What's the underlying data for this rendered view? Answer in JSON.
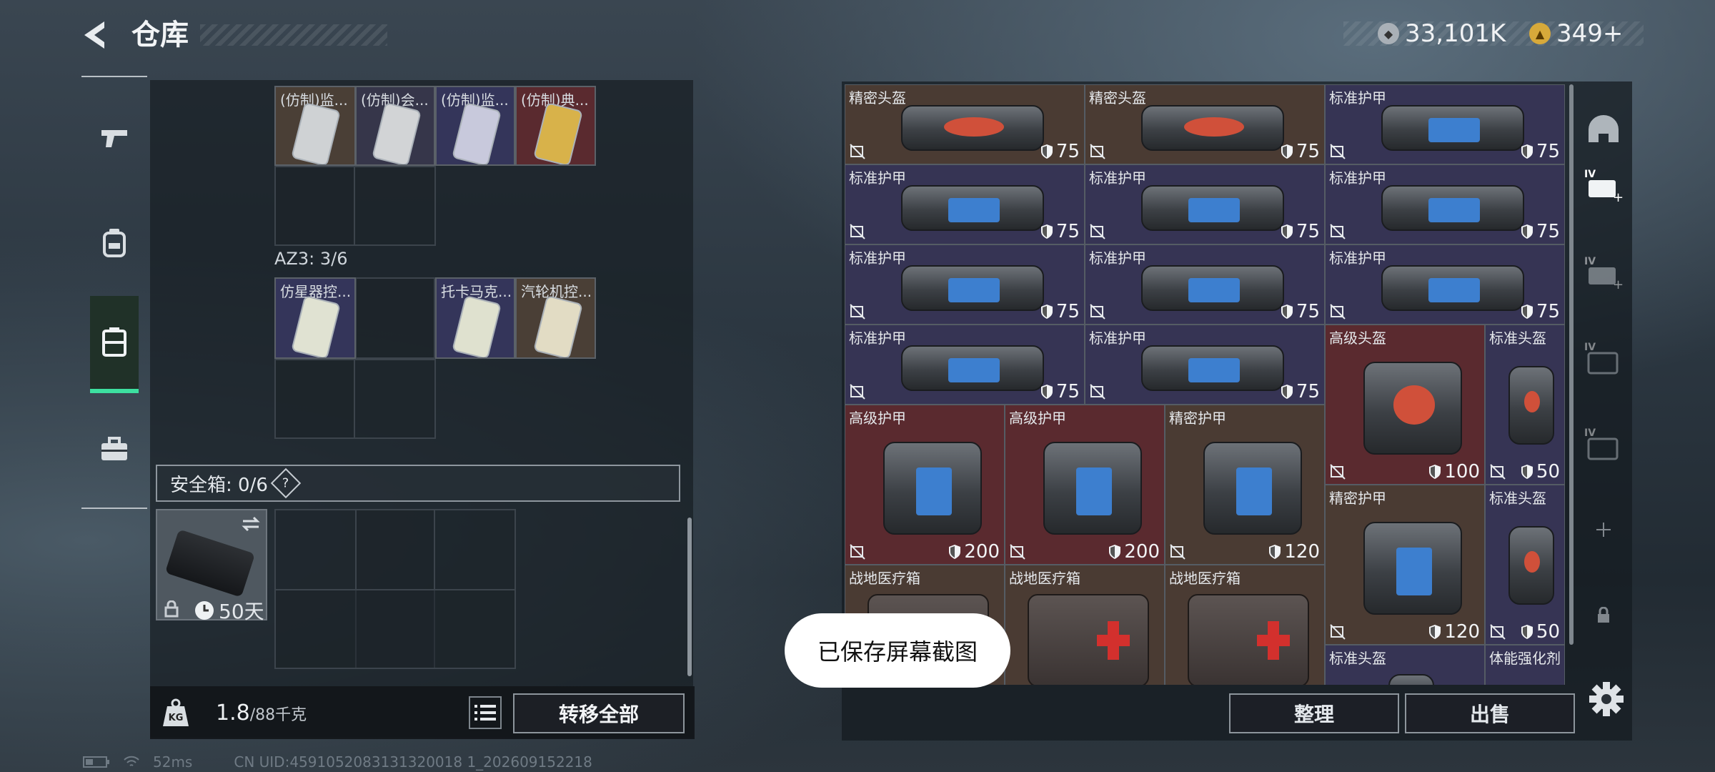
{
  "header": {
    "title": "仓库",
    "back_icon": "back-arrow-icon"
  },
  "currency": [
    {
      "icon": "silver-coin-icon",
      "value": "33,101K",
      "color": "#b8bec4"
    },
    {
      "icon": "gold-coin-icon",
      "value": "349+",
      "color": "#d7a93a"
    }
  ],
  "left_tabs": [
    {
      "name": "weapons",
      "icon": "pistol-icon"
    },
    {
      "name": "equipment",
      "icon": "backpack-icon"
    },
    {
      "name": "containers",
      "icon": "container-icon",
      "active": true
    },
    {
      "name": "toolbox",
      "icon": "toolbox-icon"
    }
  ],
  "left_items_top": [
    {
      "label": "(仿制)监...",
      "color": "#c9c9c9"
    },
    {
      "label": "(仿制)会...",
      "color": "#c9c9c9"
    },
    {
      "label": "(仿制)监...",
      "color": "#bfbfd8"
    },
    {
      "label": "(仿制)典...",
      "color": "#d8b24a"
    }
  ],
  "az3": {
    "label": "AZ3: 3/6"
  },
  "left_items_az3": [
    {
      "label": "仿星器控..."
    },
    {
      "label": "托卡马克..."
    },
    {
      "label": "汽轮机控..."
    }
  ],
  "safe_box": {
    "label": "安全箱: 0/6",
    "help": "?",
    "days": "50天"
  },
  "weight": {
    "current": "1.8",
    "max": "/88千克"
  },
  "transfer_label": "转移全部",
  "stash_items": [
    {
      "name": "精密头盔",
      "value": "75",
      "color": "brown",
      "kind": "helmet"
    },
    {
      "name": "精密头盔",
      "value": "75",
      "color": "brown",
      "kind": "helmet"
    },
    {
      "name": "标准护甲",
      "value": "75",
      "color": "purple",
      "kind": "armor"
    },
    {
      "name": "标准护甲",
      "value": "75",
      "color": "purple",
      "kind": "armor"
    },
    {
      "name": "标准护甲",
      "value": "75",
      "color": "purple",
      "kind": "armor"
    },
    {
      "name": "标准护甲",
      "value": "75",
      "color": "purple",
      "kind": "armor"
    },
    {
      "name": "标准护甲",
      "value": "75",
      "color": "purple",
      "kind": "armor"
    },
    {
      "name": "标准护甲",
      "value": "75",
      "color": "purple",
      "kind": "armor"
    },
    {
      "name": "标准护甲",
      "value": "75",
      "color": "purple",
      "kind": "armor"
    },
    {
      "name": "标准护甲",
      "value": "75",
      "color": "purple",
      "kind": "armor"
    },
    {
      "name": "标准护甲",
      "value": "75",
      "color": "purple",
      "kind": "armor"
    },
    {
      "name": "高级头盔",
      "value": "100",
      "color": "red",
      "kind": "helmet"
    },
    {
      "name": "标准头盔",
      "value": "50",
      "color": "purple",
      "kind": "helmet-s"
    },
    {
      "name": "高级护甲",
      "value": "200",
      "color": "red",
      "kind": "armor"
    },
    {
      "name": "高级护甲",
      "value": "200",
      "color": "red",
      "kind": "armor"
    },
    {
      "name": "精密护甲",
      "value": "120",
      "color": "brown",
      "kind": "armor"
    },
    {
      "name": "精密护甲",
      "value": "120",
      "color": "brown",
      "kind": "armor"
    },
    {
      "name": "标准头盔",
      "value": "50",
      "color": "purple",
      "kind": "helmet-s"
    },
    {
      "name": "战地医疗箱",
      "value": "",
      "color": "brown",
      "kind": "medkit"
    },
    {
      "name": "战地医疗箱",
      "value": "",
      "color": "brown",
      "kind": "medkit"
    },
    {
      "name": "战地医疗箱",
      "value": "",
      "color": "brown",
      "kind": "medkit"
    },
    {
      "name": "标准头盔",
      "value": "",
      "color": "purple",
      "kind": "helmet-s"
    },
    {
      "name": "体能强化剂",
      "value": "",
      "color": "purple",
      "kind": "syringe"
    }
  ],
  "right_tabs": [
    {
      "icon": "helmet-slot-icon"
    },
    {
      "icon": "iv-case-add-icon",
      "active": true
    },
    {
      "icon": "iv-case-add-icon"
    },
    {
      "icon": "iv-case-icon"
    },
    {
      "icon": "iv-case-icon"
    },
    {
      "icon": "plus-icon"
    },
    {
      "icon": "lock-icon"
    }
  ],
  "sort_label": "整理",
  "sell_label": "出售",
  "toast": "已保存屏幕截图",
  "status": {
    "ping": "52ms",
    "uid": "CN UID:4591052083131320018 1_202609152218"
  }
}
